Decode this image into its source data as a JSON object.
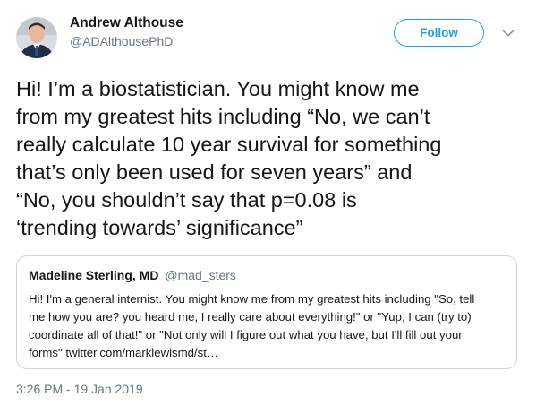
{
  "author": {
    "display_name": "Andrew Althouse",
    "handle": "@ADAlthousePhD"
  },
  "follow_button": {
    "label": "Follow"
  },
  "more_menu": {
    "icon": "chevron-down-icon"
  },
  "tweet": {
    "lines": [
      "Hi! I’m a biostatistician. You might know me",
      "from my greatest hits including “No, we can’t",
      "really calculate 10 year survival for something",
      "that’s only been used for seven years” and",
      "“No, you shouldn’t say that p=0.08 is",
      "‘trending towards’ significance”"
    ]
  },
  "quoted_tweet": {
    "display_name": "Madeline Sterling, MD",
    "handle": "@mad_sters",
    "lines": [
      "Hi! I'm a general internist. You might know me from my greatest hits including \"So, tell",
      "me how you are? you heard me, I really care about everything!\" or \"Yup, I can (try to)",
      "coordinate all of that!\" or \"Not only will I figure out what you have, but I'll fill out your",
      "forms\" twitter.com/marklewismd/st…"
    ]
  },
  "timestamp": "3:26 PM - 19 Jan 2019",
  "colors": {
    "accent": "#1da1f2",
    "secondary_text": "#657786",
    "border": "#ccd6dd"
  }
}
